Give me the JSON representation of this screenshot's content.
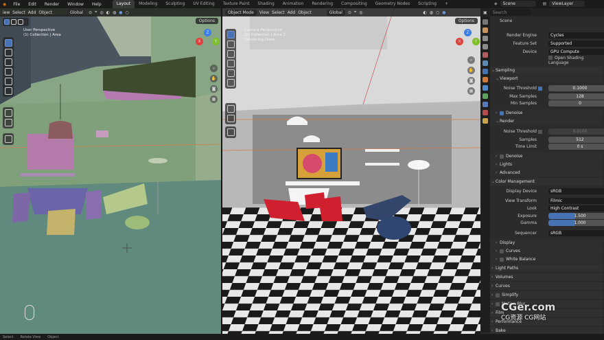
{
  "menu": [
    "File",
    "Edit",
    "Render",
    "Window",
    "Help"
  ],
  "workspaces": [
    {
      "label": "Layout",
      "active": true
    },
    {
      "label": "Modeling"
    },
    {
      "label": "Sculpting"
    },
    {
      "label": "UV Editing"
    },
    {
      "label": "Texture Paint"
    },
    {
      "label": "Shading"
    },
    {
      "label": "Animation"
    },
    {
      "label": "Rendering"
    },
    {
      "label": "Compositing"
    },
    {
      "label": "Geometry Nodes"
    },
    {
      "label": "Scripting"
    }
  ],
  "add_tab": "+",
  "scene": "Scene",
  "view_layer": "ViewLayer",
  "left_vp": {
    "header": [
      "iew",
      "Select",
      "Add",
      "Object"
    ],
    "orient": "Global",
    "line1": "User Perspective",
    "line2": "(1) Collection | Area",
    "options": "Options"
  },
  "right_vp": {
    "mode": "Object Mode",
    "header": [
      "View",
      "Select",
      "Add",
      "Object"
    ],
    "orient": "Global",
    "line1": "Camera Perspective",
    "line2": "(1) Collection | Area 2",
    "line3": "Rendering Done",
    "options": "Options"
  },
  "props": {
    "search_placeholder": "Search",
    "title": "Scene",
    "render_engine": {
      "label": "Render Engine",
      "value": "Cycles"
    },
    "feature_set": {
      "label": "Feature Set",
      "value": "Supported"
    },
    "device": {
      "label": "Device",
      "value": "GPU Compute"
    },
    "osl": "Open Shading Language",
    "sampling": "Sampling",
    "viewport": "Viewport",
    "noise_threshold": {
      "label": "Noise Threshold",
      "value": "0.1000"
    },
    "max_samples": {
      "label": "Max Samples",
      "value": "128"
    },
    "min_samples": {
      "label": "Min Samples",
      "value": "0"
    },
    "denoise": "Denoise",
    "render": "Render",
    "r_noise": {
      "label": "Noise Threshold",
      "value": "0.0100"
    },
    "samples": {
      "label": "Samples",
      "value": "512"
    },
    "time_limit": {
      "label": "Time Limit",
      "value": "0 s"
    },
    "denoise2": "Denoise",
    "lights": "Lights",
    "advanced": "Advanced",
    "color_mgmt": "Color Management",
    "display_device": {
      "label": "Display Device",
      "value": "sRGB"
    },
    "view_transform": {
      "label": "View Transform",
      "value": "Filmic"
    },
    "look": {
      "label": "Look",
      "value": "High Contrast"
    },
    "exposure": {
      "label": "Exposure",
      "value": "1.500"
    },
    "gamma": {
      "label": "Gamma",
      "value": "1.000"
    },
    "sequencer": {
      "label": "Sequencer",
      "value": "sRGB"
    },
    "display": "Display",
    "curves": "Curves",
    "white_balance": "White Balance",
    "light_paths": "Light Paths",
    "volumes": "Volumes",
    "curves2": "Curves",
    "simplify": "Simplify",
    "motion_blur": "Motion Blur",
    "f1": "Film",
    "f2": "Performance",
    "f3": "Bake"
  },
  "status": [
    "Select",
    "Rotate View",
    "Object"
  ],
  "watermark": {
    "big": "CGer.com",
    "small": "CG资源 CG网站"
  },
  "colors": {
    "accent": "#4772b3",
    "axis_x": "#e0413c",
    "axis_y": "#7fbf2a",
    "axis_z": "#3a7ee8"
  }
}
